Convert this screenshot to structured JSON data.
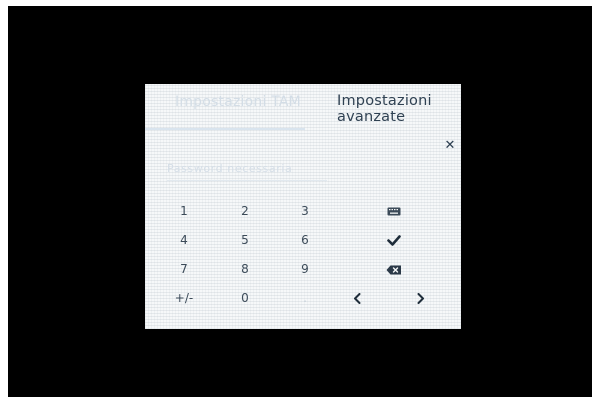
{
  "tabs": {
    "left_label": "Impostazioni TAM",
    "right_label": "Impostazioni avanzate"
  },
  "password_field": {
    "placeholder": "Password necessaria"
  },
  "keypad": {
    "rows": [
      [
        "1",
        "2",
        "3"
      ],
      [
        "4",
        "5",
        "6"
      ],
      [
        "7",
        "8",
        "9"
      ],
      [
        "+/-",
        "0",
        "."
      ]
    ],
    "icons": {
      "keyboard": "keyboard-icon",
      "confirm": "check-icon",
      "backspace": "backspace-icon",
      "left": "arrow-left-icon",
      "right": "arrow-right-icon",
      "close": "close-icon"
    }
  },
  "colors": {
    "screen_bg": "#f6f8f9",
    "text": "#3b4a58",
    "faded_text": "#d3dde6"
  }
}
